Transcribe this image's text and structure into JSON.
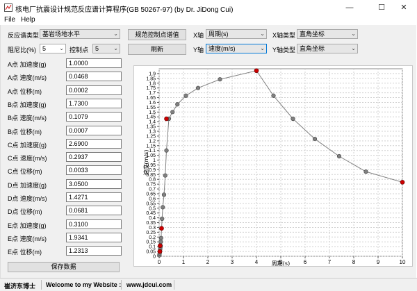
{
  "window": {
    "title": "核电厂抗震设计规范反应谱计算程序(GB 50267-97) (by Dr. JiDong Cui)",
    "minimize": "—",
    "maximize": "☐",
    "close": "✕"
  },
  "menu": {
    "file": "File",
    "help": "Help"
  },
  "controls": {
    "spectrum_type_label": "反应谱类型",
    "spectrum_type_value": "基岩场地水平",
    "damping_label": "阻尼比(%)",
    "damping_value": "5",
    "control_point_label": "控制点",
    "control_point_value": "5",
    "code_button": "规范控制点谱值",
    "refresh_button": "刷新",
    "x_axis_label": "X轴",
    "x_axis_value": "周期(s)",
    "y_axis_label": "Y轴",
    "y_axis_value": "速度(m/s)",
    "x_axis_type_label": "X轴类型",
    "x_axis_type_value": "直角坐标",
    "y_axis_type_label": "Y轴类型",
    "y_axis_type_value": "直角坐标",
    "save_button": "保存数据"
  },
  "points": [
    {
      "label": "A点 加速度(g)",
      "value": "1.0000"
    },
    {
      "label": "A点 速度(m/s)",
      "value": "0.0468"
    },
    {
      "label": "A点 位移(m)",
      "value": "0.0002"
    },
    {
      "label": "B点 加速度(g)",
      "value": "1.7300"
    },
    {
      "label": "B点 速度(m/s)",
      "value": "0.1079"
    },
    {
      "label": "B点 位移(m)",
      "value": "0.0007"
    },
    {
      "label": "C点 加速度(g)",
      "value": "2.6900"
    },
    {
      "label": "C点 速度(m/s)",
      "value": "0.2937"
    },
    {
      "label": "C点 位移(m)",
      "value": "0.0033"
    },
    {
      "label": "D点 加速度(g)",
      "value": "3.0500"
    },
    {
      "label": "D点 速度(m/s)",
      "value": "1.4271"
    },
    {
      "label": "D点 位移(m)",
      "value": "0.0681"
    },
    {
      "label": "E点 加速度(g)",
      "value": "0.3100"
    },
    {
      "label": "E点 速度(m/s)",
      "value": "1.9341"
    },
    {
      "label": "E点 位移(m)",
      "value": "1.2313"
    }
  ],
  "status": {
    "author": "崔济东博士",
    "welcome": "Welcome to my Website :",
    "url": "www.jdcui.com"
  },
  "chart_data": {
    "type": "line",
    "xlabel": "周期(s)",
    "ylabel": "速度(m/s)",
    "xlim": [
      0,
      10
    ],
    "ylim": [
      0,
      1.95
    ],
    "xticks": [
      0,
      1,
      2,
      3,
      4,
      5,
      6,
      7,
      8,
      9,
      10
    ],
    "yticks": [
      0,
      0.05,
      0.1,
      0.15,
      0.2,
      0.25,
      0.3,
      0.35,
      0.4,
      0.45,
      0.5,
      0.55,
      0.6,
      0.65,
      0.7,
      0.75,
      0.8,
      0.85,
      0.9,
      0.95,
      1,
      1.05,
      1.1,
      1.15,
      1.2,
      1.25,
      1.3,
      1.35,
      1.4,
      1.45,
      1.5,
      1.55,
      1.6,
      1.65,
      1.7,
      1.75,
      1.8,
      1.85,
      1.9
    ],
    "grid": true,
    "line_color": "#808080",
    "point_color": "#808080",
    "control_point_color": "#cc0000",
    "x": [
      0.01,
      0.02,
      0.03,
      0.04,
      0.05,
      0.06,
      0.07,
      0.08,
      0.1,
      0.12,
      0.15,
      0.2,
      0.25,
      0.3,
      0.4,
      0.55,
      0.75,
      1.1,
      1.6,
      2.5,
      4.0,
      4.7,
      5.5,
      6.4,
      7.4,
      8.5,
      10.0
    ],
    "y": [
      0.01,
      0.03,
      0.05,
      0.07,
      0.09,
      0.11,
      0.15,
      0.19,
      0.29,
      0.39,
      0.51,
      0.64,
      0.84,
      1.1,
      1.43,
      1.5,
      1.58,
      1.67,
      1.75,
      1.84,
      1.93,
      1.67,
      1.43,
      1.22,
      1.04,
      0.88,
      0.77
    ],
    "control_points": [
      {
        "name": "A",
        "x": 0.03,
        "y": 0.05
      },
      {
        "name": "B",
        "x": 0.04,
        "y": 0.11
      },
      {
        "name": "C",
        "x": 0.1,
        "y": 0.29
      },
      {
        "name": "D",
        "x": 0.3,
        "y": 1.43
      },
      {
        "name": "E",
        "x": 4.0,
        "y": 1.93
      },
      {
        "name": "end",
        "x": 10.0,
        "y": 0.77
      }
    ]
  }
}
